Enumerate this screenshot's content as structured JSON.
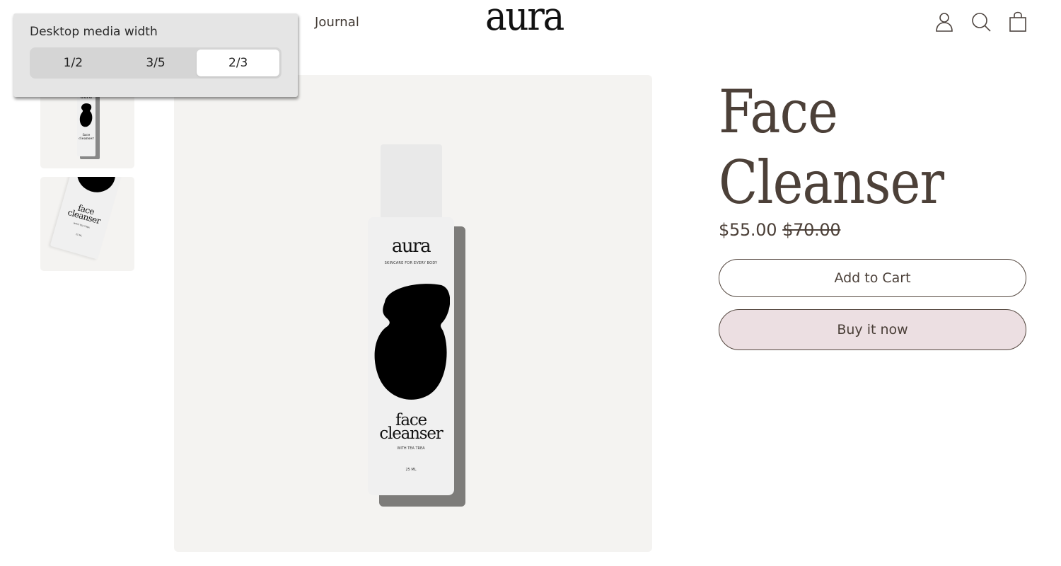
{
  "header": {
    "nav_links": [
      {
        "label": "Journal"
      }
    ],
    "logo": "aura",
    "icons": [
      {
        "name": "account-icon",
        "label": "Account"
      },
      {
        "name": "search-icon",
        "label": "Search"
      },
      {
        "name": "cart-icon",
        "label": "Cart"
      }
    ]
  },
  "popover": {
    "label": "Desktop media width",
    "options": [
      "1/2",
      "3/5",
      "2/3"
    ],
    "selected": "2/3"
  },
  "gallery": {
    "main_image": {
      "brand": "aura",
      "tagline": "SKINCARE FOR EVERY BODY",
      "product_line1": "face",
      "product_line2": "cleanser",
      "subtitle": "WITH TEA TREA",
      "volume": "25 ML"
    },
    "thumbnails": [
      {
        "brand": "aura",
        "product_line1": "face",
        "product_line2": "cleanser"
      },
      {
        "product_line1": "face",
        "product_line2": "cleanser",
        "subtitle": "WITH TEA TREA",
        "volume": "25 ML"
      }
    ]
  },
  "product": {
    "title_line1": "Face",
    "title_line2": "Cleanser",
    "price": "$55.00",
    "compare_price": "$70.00",
    "add_to_cart_label": "Add to Cart",
    "buy_now_label": "Buy it now"
  },
  "colors": {
    "text": "#4c4038",
    "buy_button_bg": "#ecdfe2",
    "media_bg": "#f4f3f1"
  }
}
